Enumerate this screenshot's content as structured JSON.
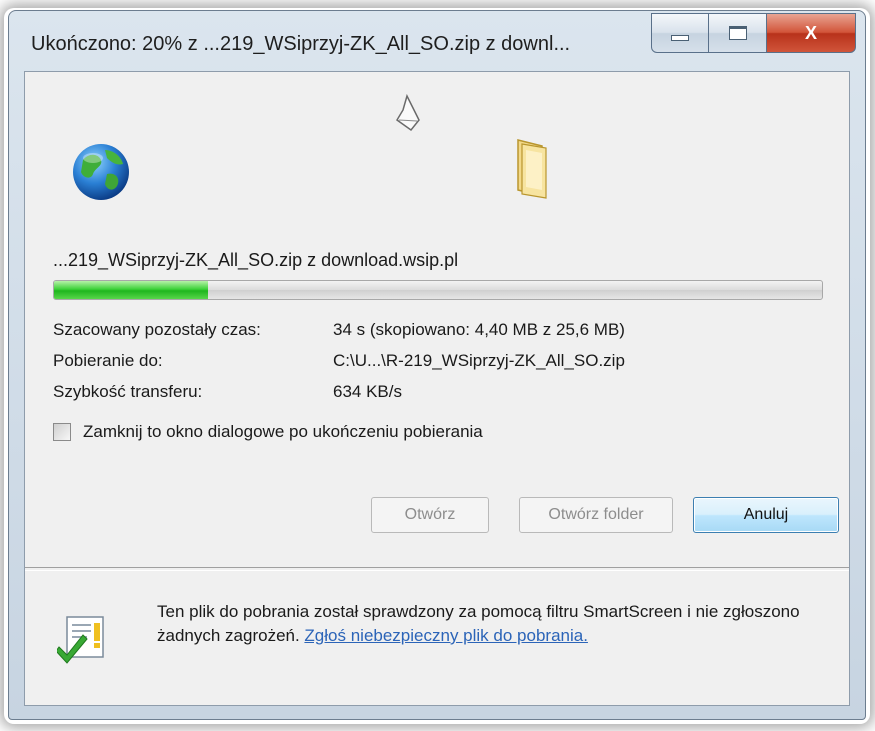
{
  "window": {
    "title": "Ukończono: 20% z ...219_WSiprzyj-ZK_All_SO.zip z downl..."
  },
  "caption_buttons": {
    "close_glyph": "X"
  },
  "download": {
    "filename_source": "...219_WSiprzyj-ZK_All_SO.zip z download.wsip.pl",
    "progress_fraction": 0.2
  },
  "details": {
    "time_label": "Szacowany pozostały czas:",
    "time_value": "34 s (skopiowano: 4,40 MB z 25,6 MB)",
    "dest_label": "Pobieranie do:",
    "dest_value": "C:\\U...\\R-219_WSiprzyj-ZK_All_SO.zip",
    "speed_label": "Szybkość transferu:",
    "speed_value": "634 KB/s"
  },
  "options": {
    "close_checkbox_label": "Zamknij to okno dialogowe po ukończeniu pobierania",
    "close_checkbox_checked": false
  },
  "buttons": {
    "open": "Otwórz",
    "open_folder": "Otwórz folder",
    "cancel": "Anuluj"
  },
  "smartscreen": {
    "message": "Ten plik do pobrania został sprawdzony za pomocą filtru SmartScreen i nie zgłoszono żadnych zagrożeń. ",
    "report_link": "Zgłoś niebezpieczny plik do pobrania."
  },
  "colors": {
    "progress_green": "#2fc22c",
    "link_blue": "#2b64b8",
    "close_red": "#c7432a"
  },
  "icons": {
    "globe": "globe-icon",
    "paper": "flying-paper-icon",
    "folder": "folder-icon",
    "smartscreen": "smartscreen-check-icon"
  }
}
